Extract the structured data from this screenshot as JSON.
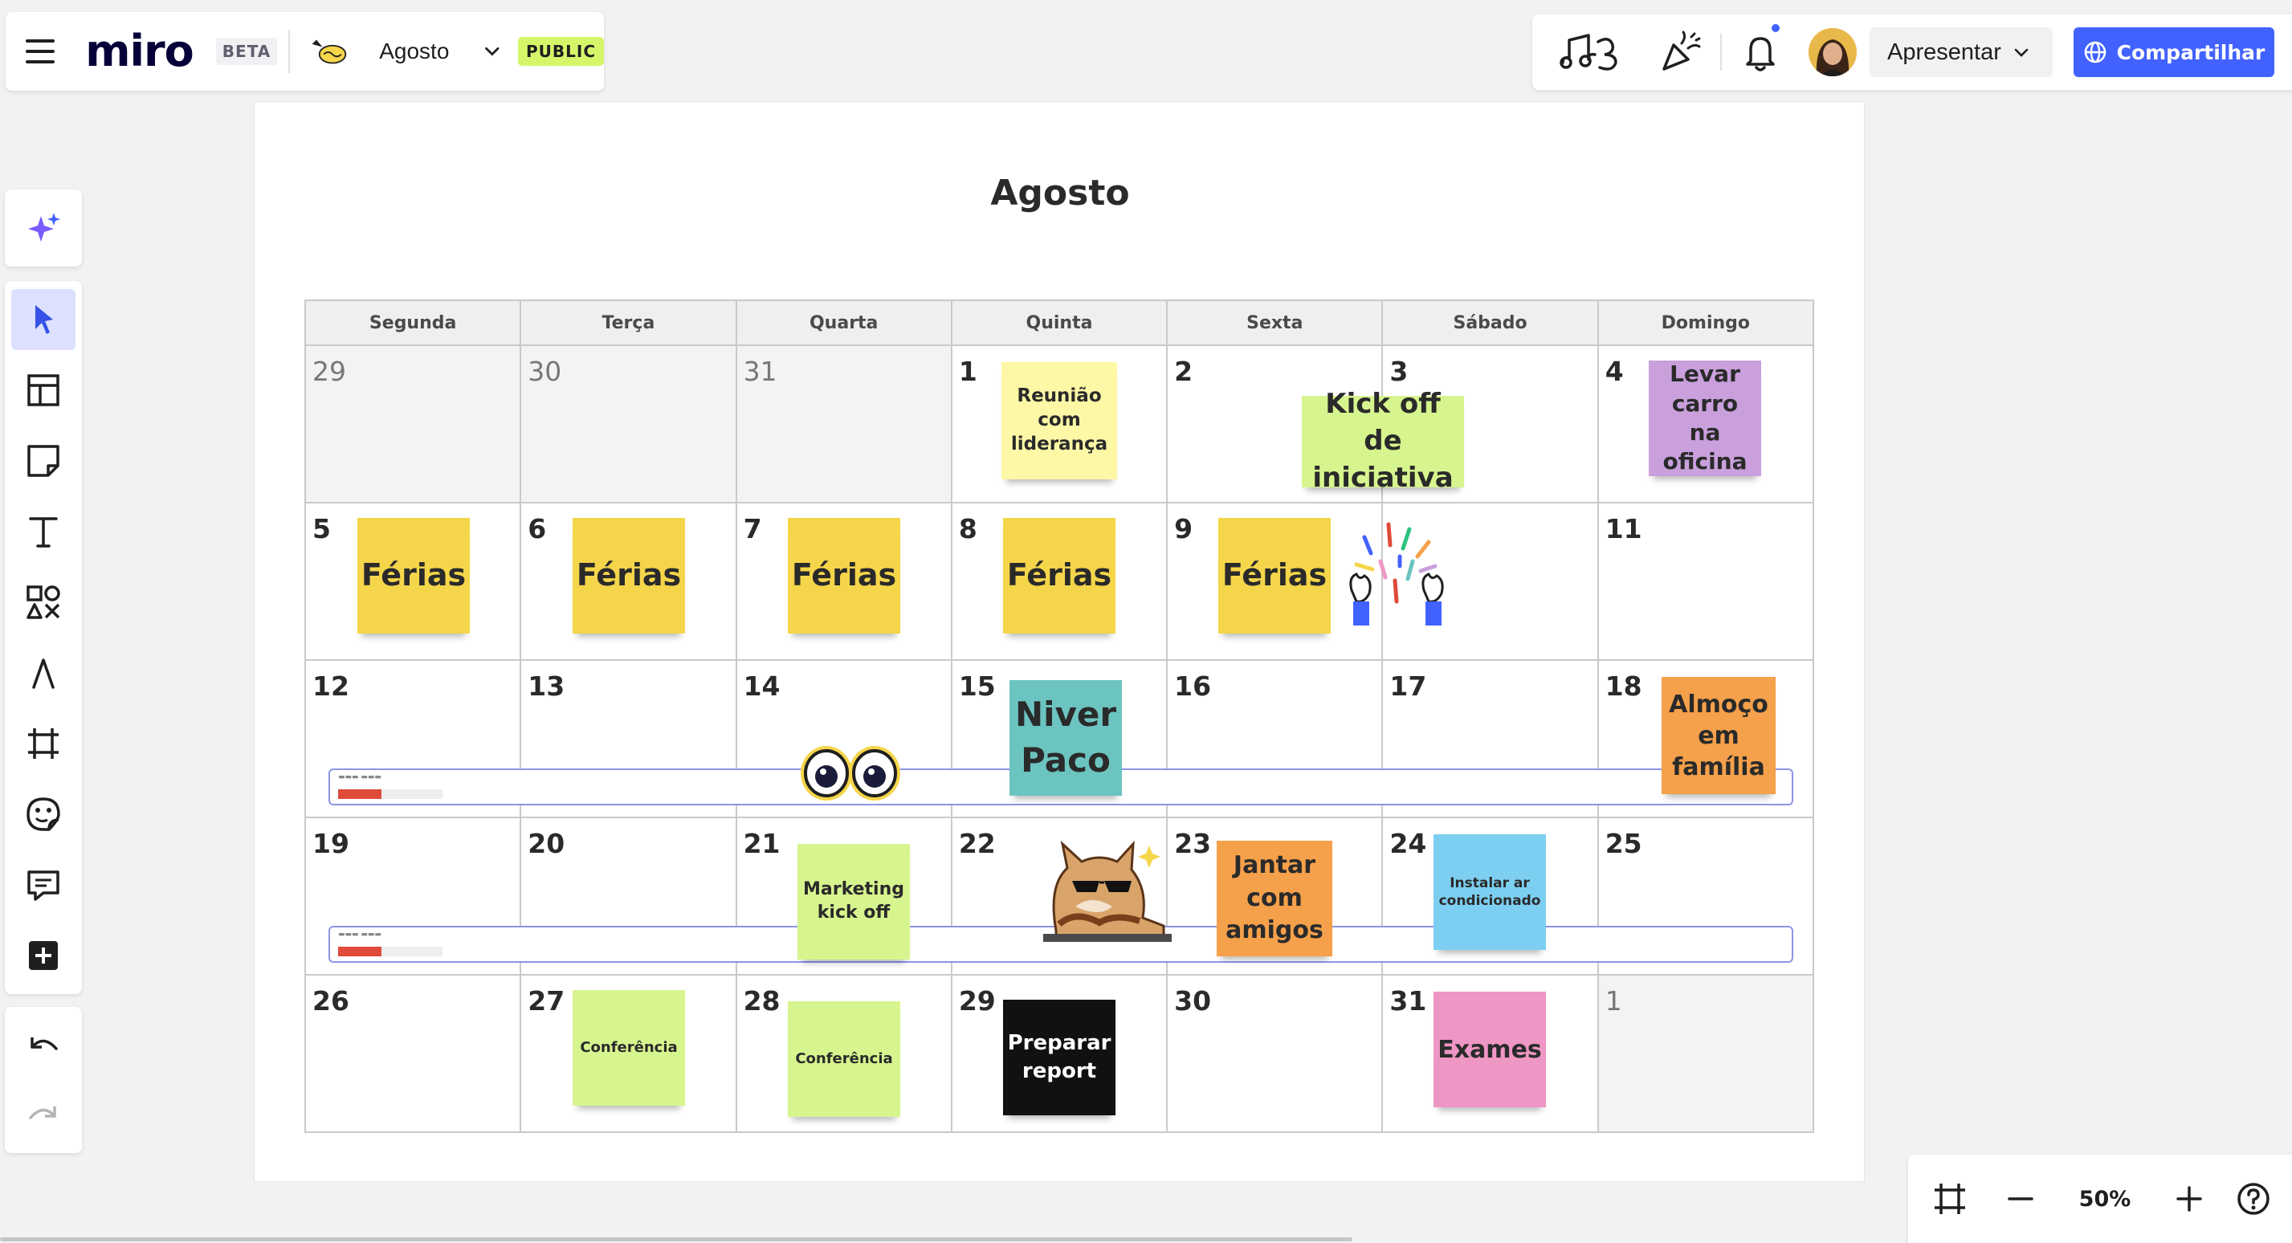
{
  "app": {
    "logo": "miro",
    "badge": "BETA",
    "board_name": "Agosto",
    "visibility": "PUBLIC"
  },
  "header": {
    "present_label": "Apresentar",
    "share_label": "Compartilhar",
    "accent_color": "#4262ff"
  },
  "toolbar": {
    "tools": [
      "ai-sparkle-icon",
      "select-cursor-icon",
      "templates-icon",
      "sticky-note-icon",
      "text-icon",
      "shapes-icon",
      "pen-icon",
      "frame-icon",
      "stickers-icon",
      "comment-icon",
      "more-apps-icon",
      "undo-icon",
      "redo-icon"
    ],
    "active_tool": "select-cursor-icon"
  },
  "calendar": {
    "title": "Agosto",
    "weekdays": [
      "Segunda",
      "Terça",
      "Quarta",
      "Quinta",
      "Sexta",
      "Sábado",
      "Domingo"
    ],
    "weeks": [
      [
        "29",
        "30",
        "31",
        "1",
        "2",
        "3",
        "4"
      ],
      [
        "5",
        "6",
        "7",
        "8",
        "9",
        "",
        "11"
      ],
      [
        "12",
        "13",
        "14",
        "15",
        "16",
        "17",
        "18"
      ],
      [
        "19",
        "20",
        "21",
        "22",
        "23",
        "24",
        "25"
      ],
      [
        "26",
        "27",
        "28",
        "29",
        "30",
        "31",
        "1"
      ]
    ],
    "outside_month": [
      [
        0,
        0
      ],
      [
        0,
        1
      ],
      [
        0,
        2
      ],
      [
        4,
        6
      ]
    ],
    "notes": {
      "reuniao": "Reunião com liderança",
      "kickoff": "Kick off de iniciativa",
      "levar_carro": "Levar carro na oficina",
      "ferias": "Férias",
      "niver": "Niver Paco",
      "almoco": "Almoço em família",
      "marketing": "Marketing kick off",
      "jantar": "Jantar com amigos",
      "instalar": "Instalar ar condicionado",
      "conferencia": "Conferência",
      "preparar": "Preparar report",
      "exames": "Exames"
    },
    "note_colors": {
      "light_yellow": "#fdf8a6",
      "yellow": "#f5d54a",
      "green": "#d7f58e",
      "purple": "#c9a0dc",
      "teal": "#6cc4c0",
      "orange": "#f5a04a",
      "blue": "#7ccff0",
      "black": "#111111",
      "pink": "#ee96c4"
    }
  },
  "zoom": {
    "value": "50%"
  }
}
